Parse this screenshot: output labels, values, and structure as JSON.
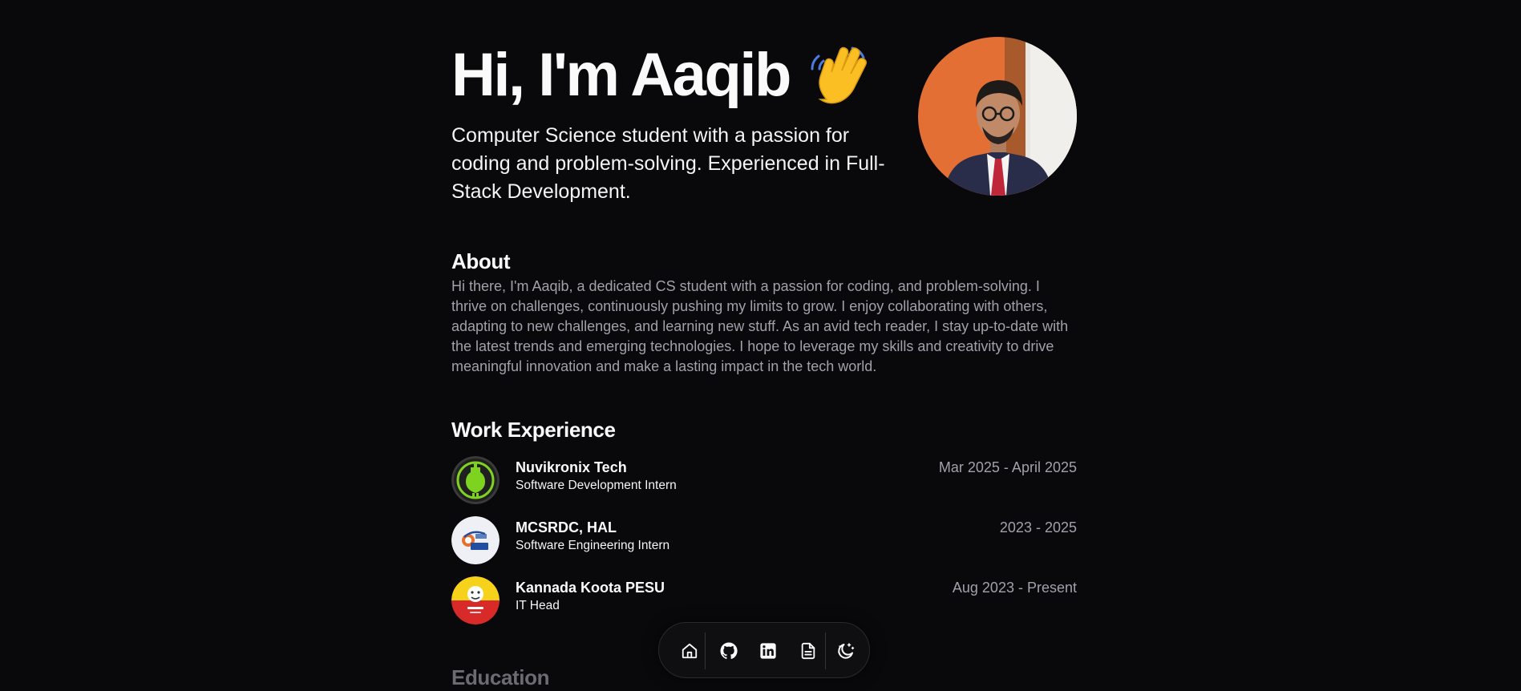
{
  "hero": {
    "title": "Hi, I'm Aaqib",
    "wave_icon": "waving-hand-emoji",
    "subtitle": "Computer Science student with a passion for coding and problem-solving. Experienced in Full-Stack Development.",
    "avatar": "profile-photo"
  },
  "about": {
    "title": "About",
    "body": "Hi there, I'm Aaqib, a dedicated CS student with a passion for coding, and problem-solving. I thrive on challenges, continuously pushing my limits to grow. I enjoy collaborating with others, adapting to new challenges, and learning new stuff. As an avid tech reader, I stay up-to-date with the latest trends and emerging technologies. I hope to leverage my skills and creativity to drive meaningful innovation and make a lasting impact in the tech world."
  },
  "work": {
    "title": "Work Experience",
    "items": [
      {
        "company": "Nuvikronix Tech",
        "role": "Software Development Intern",
        "dates": "Mar 2025 - April 2025",
        "logo": "nuvikronix-logo"
      },
      {
        "company": "MCSRDC, HAL",
        "role": "Software Engineering Intern",
        "dates": "2023 - 2025",
        "logo": "hal-logo"
      },
      {
        "company": "Kannada Koota PESU",
        "role": "IT Head",
        "dates": "Aug 2023 - Present",
        "logo": "kannada-koota-logo"
      }
    ]
  },
  "education": {
    "title": "Education"
  },
  "dock": {
    "icons": [
      "home-icon",
      "github-icon",
      "linkedin-icon",
      "resume-icon",
      "theme-toggle-icon"
    ]
  },
  "colors": {
    "background": "#09090b",
    "text": "#fafafa",
    "muted": "#a1a1aa",
    "accent_orange": "#e8773e"
  }
}
